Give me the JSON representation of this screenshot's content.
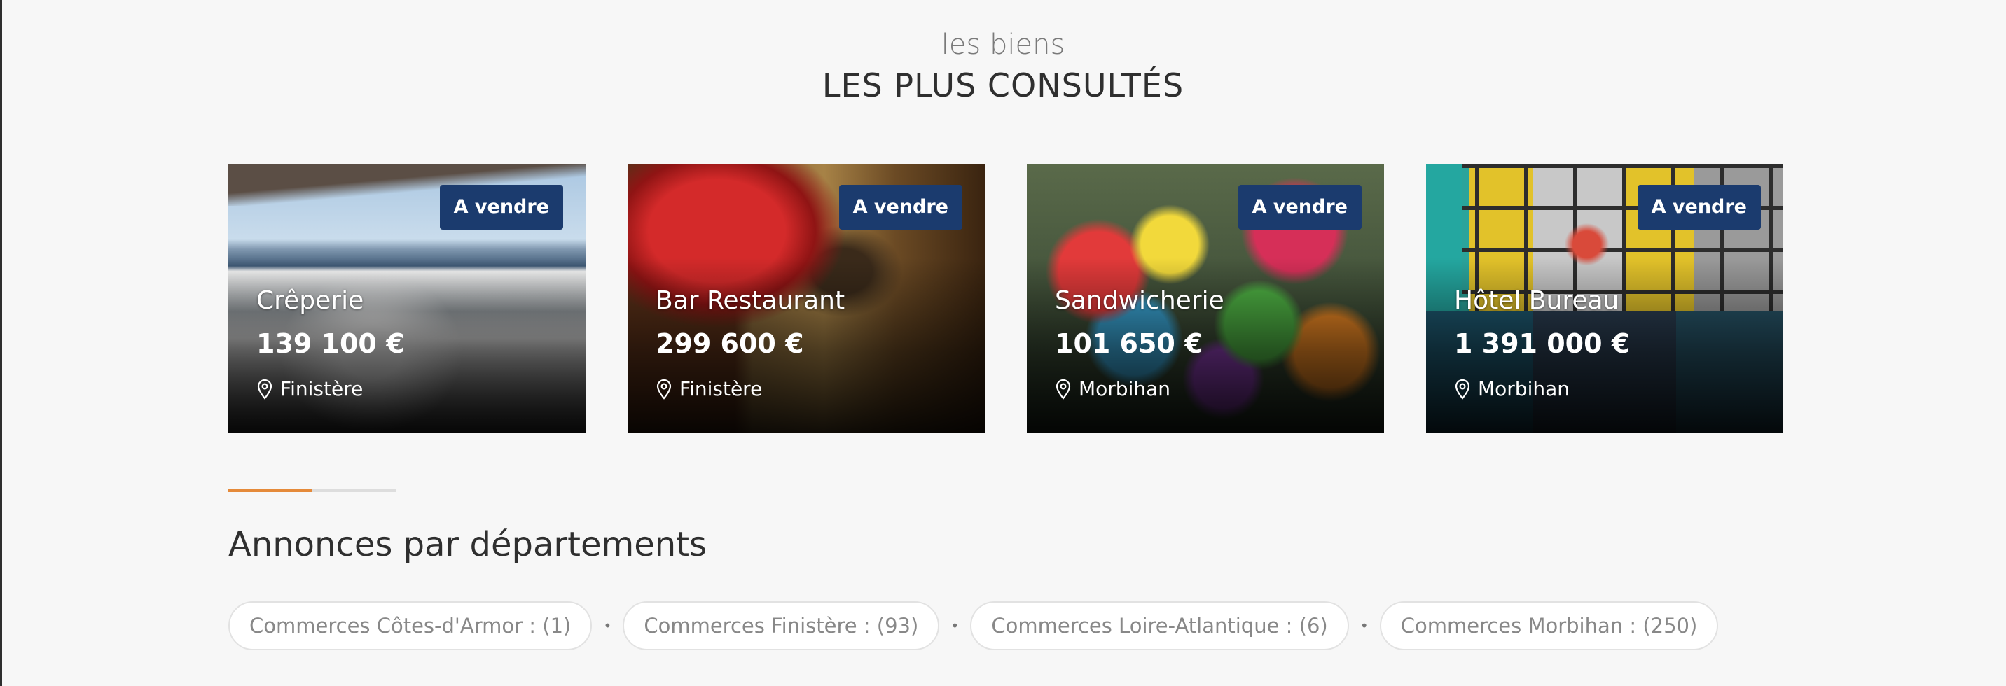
{
  "section": {
    "subtitle": "les biens",
    "title": "LES PLUS CONSULTÉS"
  },
  "cards": [
    {
      "badge": "A vendre",
      "name": "Crêperie",
      "price": "139 100 €",
      "location": "Finistère"
    },
    {
      "badge": "A vendre",
      "name": "Bar Restaurant",
      "price": "299 600 €",
      "location": "Finistère"
    },
    {
      "badge": "A vendre",
      "name": "Sandwicherie",
      "price": "101 650 €",
      "location": "Morbihan"
    },
    {
      "badge": "A vendre",
      "name": "Hôtel Bureau",
      "price": "1 391 000 €",
      "location": "Morbihan"
    }
  ],
  "carousel": {
    "progress": 0.5
  },
  "departments": {
    "title": "Annonces par départements",
    "items": [
      "Commerces Côtes-d'Armor : (1)",
      "Commerces Finistère : (93)",
      "Commerces Loire-Atlantique : (6)",
      "Commerces Morbihan : (250)"
    ]
  },
  "colors": {
    "badge": "#1b3b6e",
    "accent": "#e58a3a",
    "background": "#f7f7f7"
  }
}
